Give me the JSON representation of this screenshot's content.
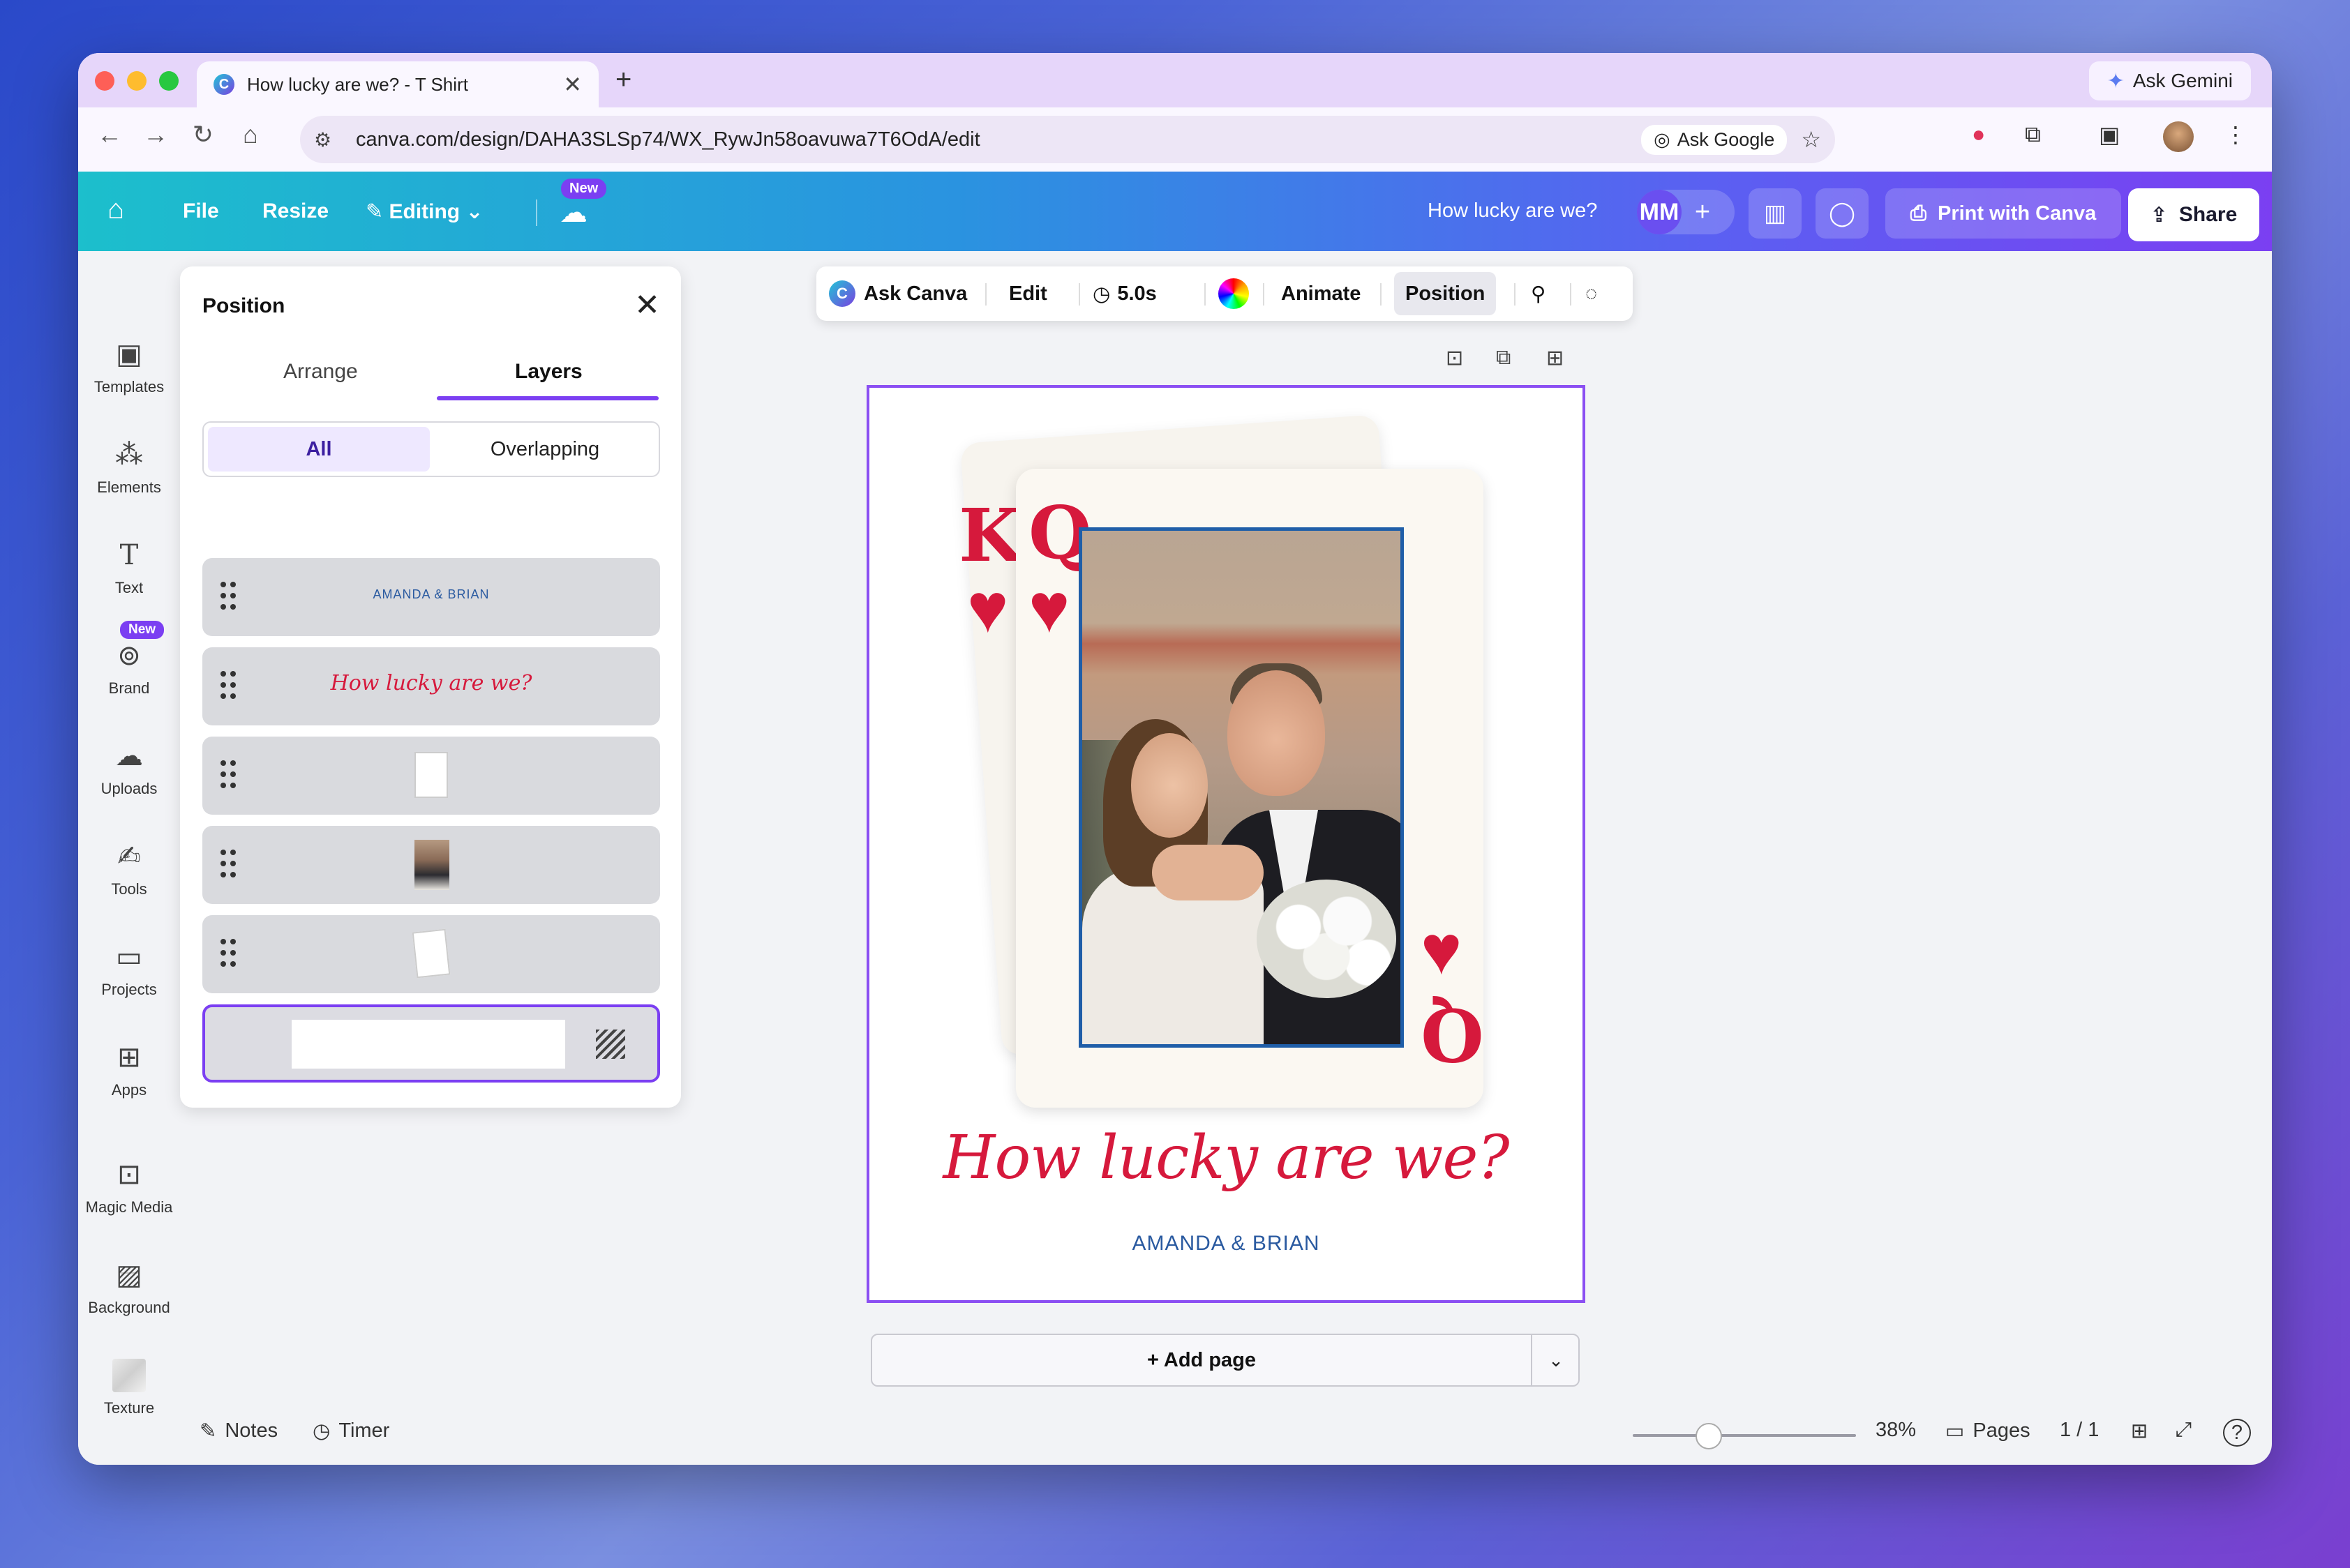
{
  "browser": {
    "tab_title": "How lucky are we? - T Shirt",
    "tab_close": "✕",
    "new_tab": "+",
    "ask_gemini": "Ask Gemini",
    "url": "canva.com/design/DAHA3SLSp74/WX_RywJn58oavuwa7T6OdA/edit",
    "ask_google": "Ask Google"
  },
  "topbar": {
    "file": "File",
    "resize": "Resize",
    "editing": "Editing",
    "new_badge": "New",
    "design_name": "How lucky are we?",
    "avatar_initials": "MM",
    "print_label": "Print with Canva",
    "share_label": "Share"
  },
  "rail": {
    "items": [
      {
        "label": "Templates",
        "icon": "templates-icon"
      },
      {
        "label": "Elements",
        "icon": "elements-icon"
      },
      {
        "label": "Text",
        "icon": "text-icon"
      },
      {
        "label": "Brand",
        "icon": "brand-icon"
      },
      {
        "label": "Uploads",
        "icon": "uploads-icon"
      },
      {
        "label": "Tools",
        "icon": "tools-icon"
      },
      {
        "label": "Projects",
        "icon": "projects-icon"
      },
      {
        "label": "Apps",
        "icon": "apps-icon"
      },
      {
        "label": "Magic Media",
        "icon": "magic-media-icon"
      },
      {
        "label": "Background",
        "icon": "background-icon"
      },
      {
        "label": "Texture",
        "icon": "texture-icon"
      }
    ],
    "new_badge": "New"
  },
  "panel": {
    "title": "Position",
    "tabs": [
      "Arrange",
      "Layers"
    ],
    "active_tab": "Layers",
    "filters": [
      "All",
      "Overlapping"
    ],
    "active_filter": "All",
    "layers": [
      {
        "thumb_text": "AMANDA & BRIAN"
      },
      {
        "thumb_text": "How lucky are we?"
      }
    ]
  },
  "toolbar": {
    "ask_canva": "Ask Canva",
    "edit": "Edit",
    "duration": "5.0s",
    "animate": "Animate",
    "position": "Position"
  },
  "design": {
    "rank_back": "K",
    "rank_front": "Q",
    "suit": "♥",
    "headline": "How lucky are we?",
    "names": "AMANDA & BRIAN",
    "accent_red": "#d6193c",
    "accent_blue": "#1f5ea8",
    "selection_purple": "#8b4ff2"
  },
  "add_page": {
    "label": "+ Add page"
  },
  "bottom": {
    "notes": "Notes",
    "timer": "Timer",
    "zoom": "38%",
    "zoom_fraction": 0.38,
    "pages": "Pages",
    "page_count": "1 / 1",
    "help": "?"
  }
}
